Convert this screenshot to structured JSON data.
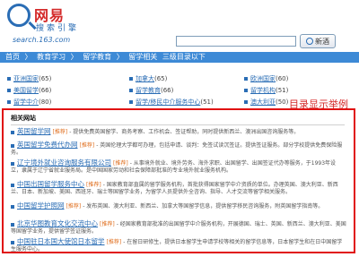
{
  "header": {
    "brand": "网易",
    "sub": "搜索引擎",
    "url": "search.163.com",
    "search_value": "",
    "search_button": "新酒"
  },
  "breadcrumb": [
    "首页",
    "〉",
    "教育学习",
    "〉",
    "留学教育",
    "〉",
    "留学相关",
    "三级目录以下"
  ],
  "categories": [
    {
      "name": "亚洲国家",
      "count": "(65)"
    },
    {
      "name": "加拿大",
      "count": "(65)"
    },
    {
      "name": "欧洲国家",
      "count": "(60)"
    },
    {
      "name": "美国留学",
      "count": "(66)"
    },
    {
      "name": "留学教育",
      "count": "(66)"
    },
    {
      "name": "留学机构",
      "count": "(51)"
    },
    {
      "name": "留学中介",
      "count": "(80)"
    },
    {
      "name": "留学/移民中介服务中心",
      "count": "(51)"
    },
    {
      "name": "澳大利亚",
      "count": "(50)"
    }
  ],
  "annotation": "目录显示举例",
  "related": {
    "title": "相关网站",
    "entries": [
      {
        "name": "英国留学网",
        "tag": "[推荐]",
        "desc": "- 提供免费英国留学、商务考察、工作机会、签证帮助，同时提供新西兰、澳洲出国咨询服务等。"
      },
      {
        "name": "英国留学免费代办网",
        "tag": "[推荐]",
        "desc": "- 英国伦理大学都可办理，包括申请、谈判：免签试读沉签证。提供签证服务。部分学校提供免费保险服务。"
      },
      {
        "name": "辽宁境外就业咨询服务有限公司",
        "tag": "[推荐]",
        "desc": "- 从事境外就业、境外劳务、海外求职、出国留学、出国签证代办等服务，于1993年设立，隶属于辽宁省就业服务局。是中国国家劳动和社会保障部批准的专业境外就业服务机构。"
      },
      {
        "name": "中国出国留学服务中心",
        "tag": "[推荐]",
        "desc": "- 国家教育部直属的留学服务机构，首批获得国家留学中介资质的单位。办理英国、澳大利亚、新西兰、日本、新加坡、美国、西班牙、瑞士等国留学业务，为留学人员提供外全咨询、指导、人才交流等留学相关服务。"
      },
      {
        "name": "中国留学护照网",
        "tag": "[推荐]",
        "desc": "- 发布英国、澳大利亚、新西兰、加拿大等国留学信息，提供留学移民咨询服务，附英国留学指南等。"
      },
      {
        "name": "北京华图教育文化交流中心",
        "tag": "[推荐]",
        "desc": "- 经国家教育部批准的出国留学中介服务机构，开展德国、瑞士、英国、新西兰、澳大利亚、美国等国留学业务，提供留学签证服务。"
      },
      {
        "name": "中国驻日本国大使馆日本留学",
        "tag": "[推荐]",
        "desc": "- 在留日研修生，提供日本留学生申请学校等相关的留学信息等，日本留学生和在日中国留学生服务中心。"
      }
    ]
  }
}
